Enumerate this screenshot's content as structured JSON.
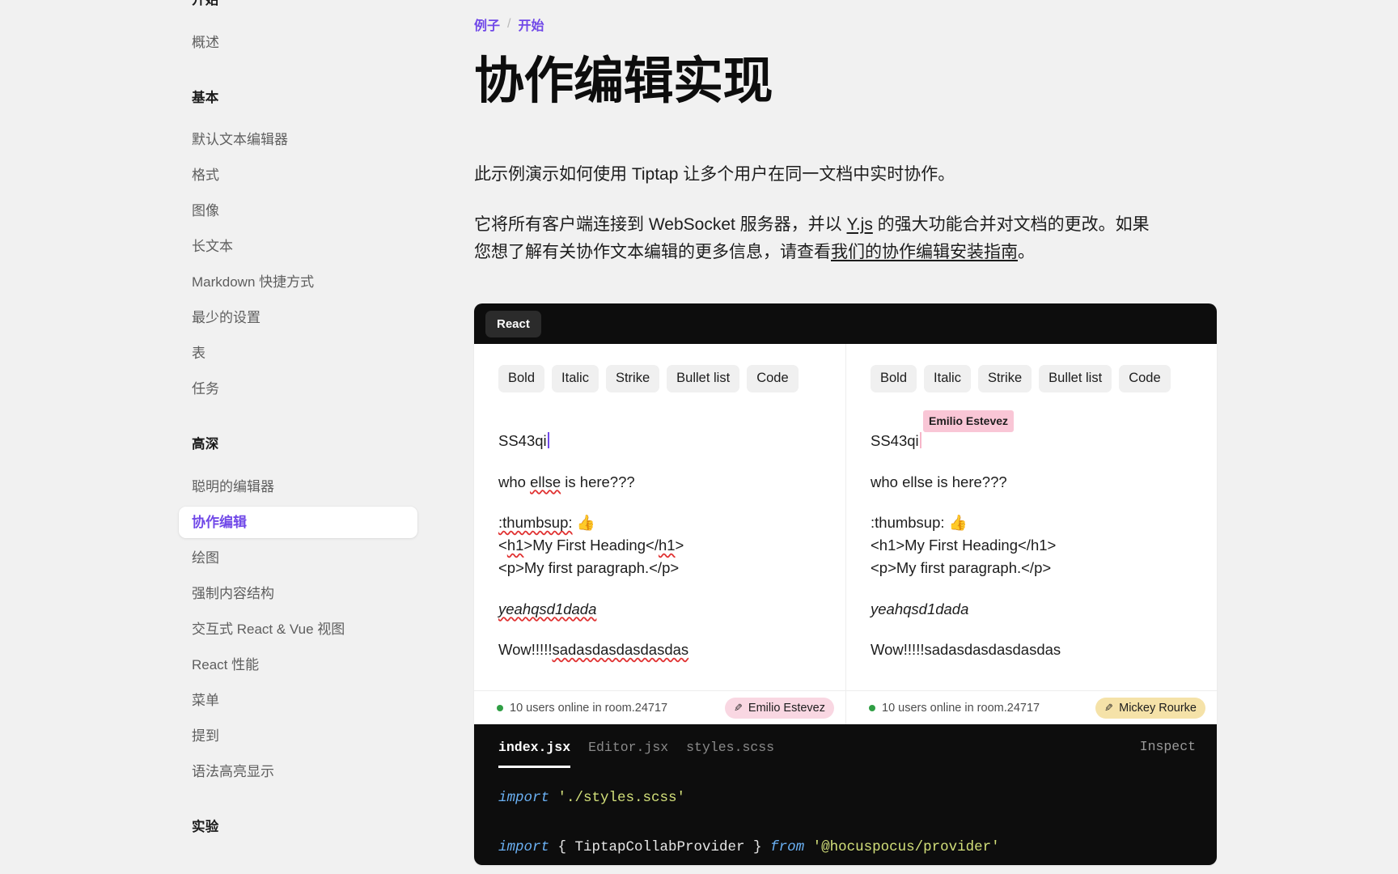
{
  "sidebar": {
    "groups": [
      {
        "heading": "开始",
        "items": [
          {
            "label": "概述",
            "active": false
          }
        ]
      },
      {
        "heading": "基本",
        "items": [
          {
            "label": "默认文本编辑器",
            "active": false
          },
          {
            "label": "格式",
            "active": false
          },
          {
            "label": "图像",
            "active": false
          },
          {
            "label": "长文本",
            "active": false
          },
          {
            "label": "Markdown 快捷方式",
            "active": false
          },
          {
            "label": "最少的设置",
            "active": false
          },
          {
            "label": "表",
            "active": false
          },
          {
            "label": "任务",
            "active": false
          }
        ]
      },
      {
        "heading": "高深",
        "items": [
          {
            "label": "聪明的编辑器",
            "active": false
          },
          {
            "label": "协作编辑",
            "active": true
          },
          {
            "label": "绘图",
            "active": false
          },
          {
            "label": "强制内容结构",
            "active": false
          },
          {
            "label": "交互式 React & Vue 视图",
            "active": false
          },
          {
            "label": "React 性能",
            "active": false
          },
          {
            "label": "菜单",
            "active": false
          },
          {
            "label": "提到",
            "active": false
          },
          {
            "label": "语法高亮显示",
            "active": false
          }
        ]
      },
      {
        "heading": "实验",
        "items": []
      }
    ]
  },
  "breadcrumb": {
    "root": "例子",
    "separator": "/",
    "current": "开始"
  },
  "page": {
    "title": "协作编辑实现",
    "paragraph1": "此示例演示如何使用 Tiptap 让多个用户在同一文档中实时协作。",
    "paragraph2_a": "它将所有客户端连接到 WebSocket 服务器，并以 ",
    "paragraph2_link1": "Y.js",
    "paragraph2_b": " 的强大功能合并对文档的更改。如果您想了解有关协作文本编辑的更多信息，请查看",
    "paragraph2_link2": "我们的协作编辑安装指南",
    "paragraph2_c": "。"
  },
  "demo": {
    "framework_tab": "React",
    "toolbar": [
      "Bold",
      "Italic",
      "Strike",
      "Bullet list",
      "Code"
    ],
    "document": {
      "line_heading": "SS43qi",
      "line_question": "who ellse is here???",
      "line_emoji_prefix": ":thumbsup:",
      "line_emoji": "👍",
      "line_h1": "<h1>My First Heading</h1>",
      "line_p": "<p>My first paragraph.</p>",
      "line_italic": "yeahqsd1dada",
      "line_wow": "Wow!!!!!sadasdasdasdasdas"
    },
    "left_pane": {
      "status": "10 users online in room.24717",
      "user": "Emilio Estevez",
      "user_color": "#f9d7e2",
      "remote_label": null
    },
    "right_pane": {
      "status": "10 users online in room.24717",
      "user": "Mickey Rourke",
      "user_color": "#f5e2a8",
      "remote_label": "Emilio Estevez"
    }
  },
  "code": {
    "tabs": [
      {
        "label": "index.jsx",
        "active": true
      },
      {
        "label": "Editor.jsx",
        "active": false
      },
      {
        "label": "styles.scss",
        "active": false
      }
    ],
    "inspect": "Inspect",
    "line1_kw": "import",
    "line1_str": "'./styles.scss'",
    "line2_kw": "import",
    "line2_braces": " { TiptapCollabProvider } ",
    "line2_from": "from",
    "line2_str": "'@hocuspocus/provider'"
  },
  "colors": {
    "accent": "#7048e8",
    "page_bg": "#f1f1f1",
    "dark": "#0d0d0d",
    "online_dot": "#2f9e44"
  }
}
